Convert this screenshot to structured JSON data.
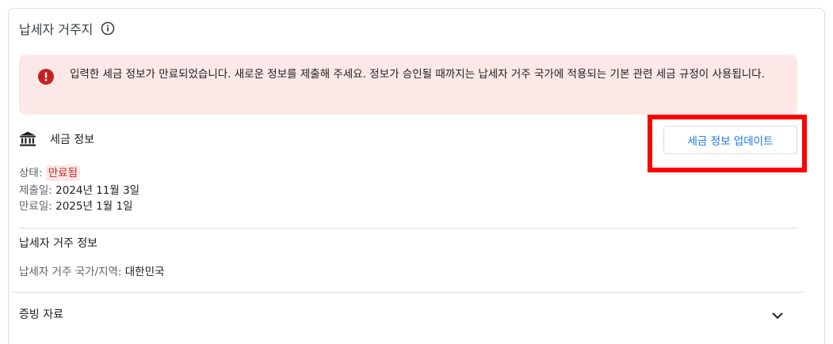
{
  "card": {
    "title": "납세자 거주지"
  },
  "alert": {
    "message": "입력한 세금 정보가 만료되었습니다. 새로운 정보를 제출해 주세요. 정보가 승인될 때까지는 납세자 거주 국가에 적용되는 기본 관련 세금 규정이 사용됩니다.",
    "icon": "error-icon",
    "color": "#c5221f",
    "background": "#fce8e6"
  },
  "tax_info": {
    "label": "세금 정보",
    "icon": "bank-icon",
    "update_button": "세금 정보 업데이트",
    "status_label": "상태:",
    "status_value": "만료됨",
    "submitted_label": "제출일:",
    "submitted_value": "2024년 11월 3일",
    "expires_label": "만료일:",
    "expires_value": "2025년 1월 1일"
  },
  "residence": {
    "title": "납세자 거주 정보",
    "country_label": "납세자 거주 국가/지역:",
    "country_value": "대한민국"
  },
  "evidence": {
    "title": "증빙 자료",
    "icon": "chevron-down-icon"
  },
  "colors": {
    "accent": "#1a73e8",
    "error": "#c5221f",
    "highlight_box": "#ff0000"
  }
}
